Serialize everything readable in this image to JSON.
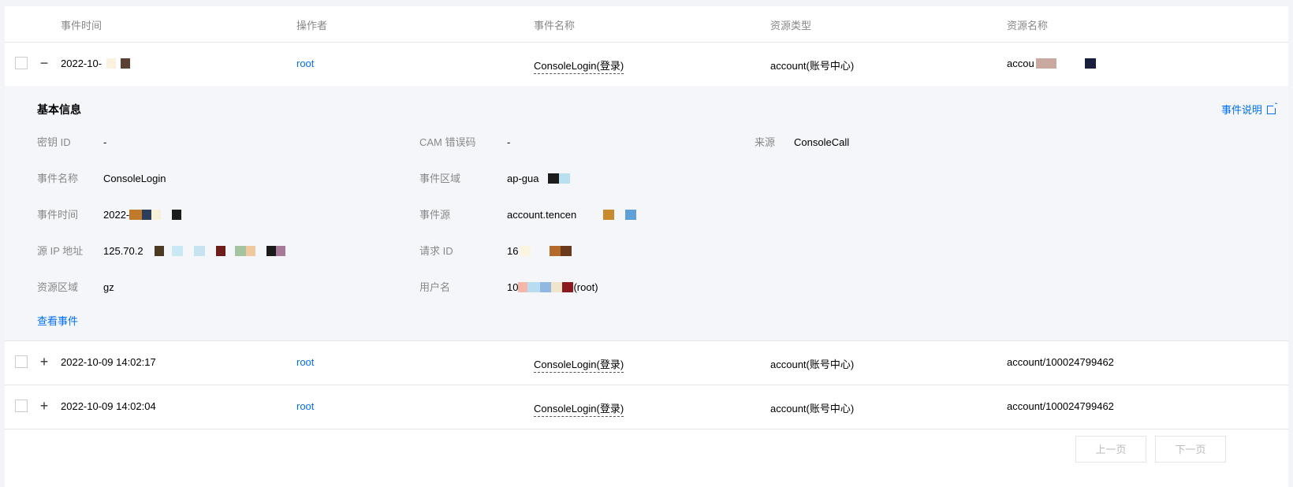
{
  "table": {
    "headers": [
      "事件时间",
      "操作者",
      "事件名称",
      "资源类型",
      "资源名称"
    ],
    "rows": [
      {
        "toggle": "−",
        "time": "2022-10-",
        "operator": "root",
        "event": "ConsoleLogin(登录)",
        "resource_type": "account(账号中心)",
        "resource_name": "accou"
      },
      {
        "toggle": "+",
        "time": "2022-10-09 14:02:17",
        "operator": "root",
        "event": "ConsoleLogin(登录)",
        "resource_type": "account(账号中心)",
        "resource_name": "account/100024799462"
      },
      {
        "toggle": "+",
        "time": "2022-10-09 14:02:04",
        "operator": "root",
        "event": "ConsoleLogin(登录)",
        "resource_type": "account(账号中心)",
        "resource_name": "account/100024799462"
      }
    ]
  },
  "detail": {
    "title": "基本信息",
    "doc_link": "事件说明",
    "fields": {
      "key_id": {
        "label": "密钥 ID",
        "value": "-"
      },
      "cam_error": {
        "label": "CAM 错误码",
        "value": "-"
      },
      "source": {
        "label": "来源",
        "value": "ConsoleCall"
      },
      "event_name": {
        "label": "事件名称",
        "value": "ConsoleLogin"
      },
      "event_region": {
        "label": "事件区域",
        "value": "ap-gua"
      },
      "event_time": {
        "label": "事件时间",
        "value": "2022-"
      },
      "event_source": {
        "label": "事件源",
        "value": "account.tencen"
      },
      "source_ip": {
        "label": "源 IP 地址",
        "value": "125.70.2"
      },
      "request_id": {
        "label": "请求 ID",
        "value": "16"
      },
      "resource_region": {
        "label": "资源区域",
        "value": "gz"
      },
      "username": {
        "label": "用户名",
        "value": "10",
        "suffix": "(root)"
      }
    },
    "view_events": "查看事件"
  },
  "pager": {
    "prev": "上一页",
    "next": "下一页"
  },
  "colors": {
    "link": "#006eff",
    "detail_bg": "#f4f6fa",
    "border": "#e5e5e5"
  }
}
